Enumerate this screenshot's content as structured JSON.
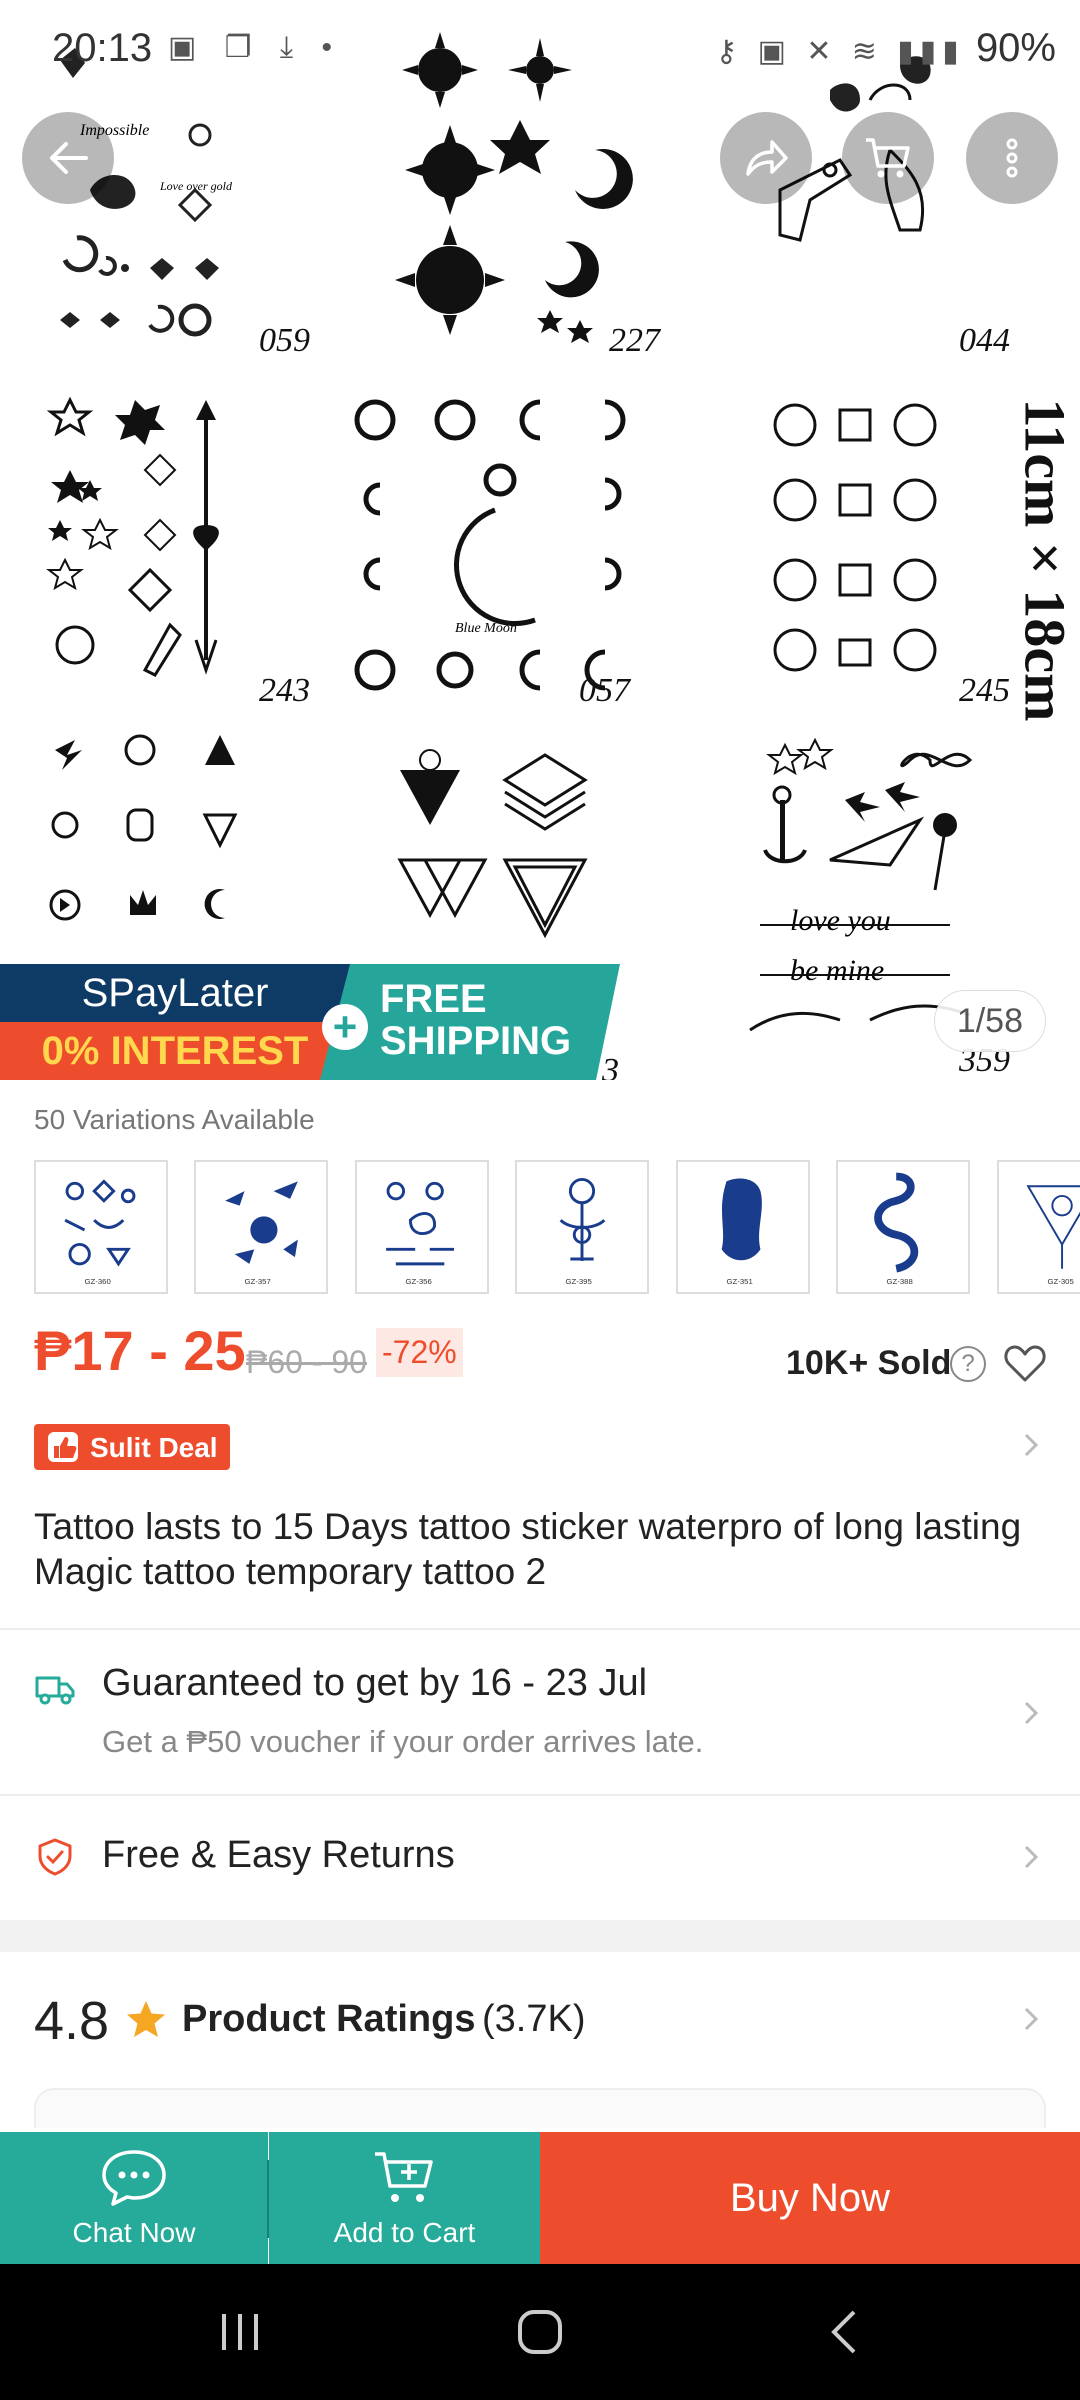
{
  "status_bar": {
    "time": "20:13",
    "icons_left": "▣ ❐ ⤓ •",
    "icons_right": "⚷ ▣ ✕ ≋ ▮▮▮",
    "battery": "90%"
  },
  "hero": {
    "tile_numbers": [
      "059",
      "227",
      "044",
      "243",
      "057",
      "245",
      "3",
      "359"
    ],
    "size_label": "11cm × 18cm",
    "page_indicator": "1/58"
  },
  "promo": {
    "paylater": "SPayLater",
    "interest": "0% INTEREST",
    "shipping_line1": "FREE",
    "shipping_line2": "SHIPPING",
    "plus": "+"
  },
  "variations": {
    "label": "50 Variations Available",
    "thumbnails": [
      "GZ-360",
      "GZ-357",
      "GZ-356",
      "GZ-395",
      "GZ-351",
      "GZ-388",
      "GZ-305"
    ]
  },
  "price": {
    "current": "₱17 - 25",
    "original": "₱60 - 90",
    "discount": "-72%",
    "sold": "10K+ Sold",
    "help": "?"
  },
  "deal": {
    "label": "Sulit Deal"
  },
  "product": {
    "title": "Tattoo lasts to 15 Days tattoo sticker waterpro of long lasting Magic tattoo temporary tattoo 2"
  },
  "shipping": {
    "guarantee": "Guaranteed to get by 16 - 23 Jul",
    "voucher": "Get a ₱50 voucher if your order arrives late."
  },
  "returns": {
    "label": "Free & Easy Returns"
  },
  "ratings": {
    "score": "4.8",
    "label": "Product Ratings",
    "count": "(3.7K)"
  },
  "bottom_bar": {
    "chat": "Chat Now",
    "cart": "Add to Cart",
    "buy": "Buy Now"
  },
  "colors": {
    "brand_orange": "#ee4d2d",
    "teal": "#26aa99",
    "navy": "#0d3b66"
  }
}
